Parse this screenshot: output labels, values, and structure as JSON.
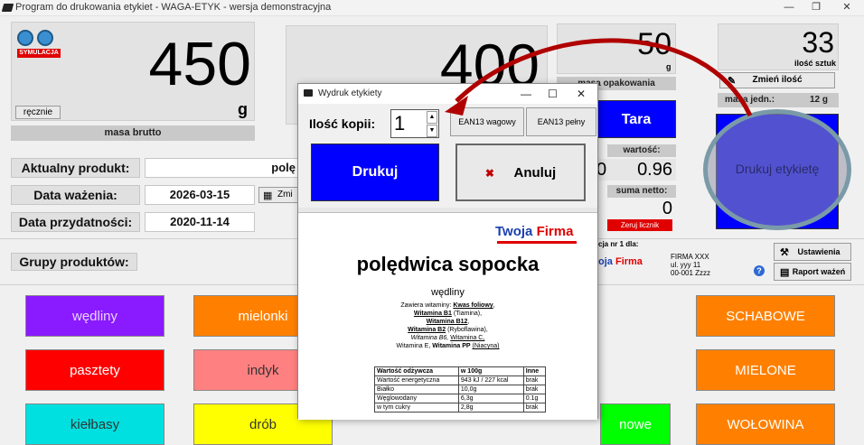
{
  "window": {
    "title": "Program do drukowania etykiet - WAGA-ETYK - wersja demonstracyjna",
    "btn_min": "—",
    "btn_restore": "❐",
    "btn_close": "✕"
  },
  "scale": {
    "mode_badge": "SYMULACJA",
    "manual_btn": "ręcznie",
    "gross_value": "450",
    "gross_unit": "g",
    "gross_caption": "masa brutto",
    "net_value": "400",
    "tare_value": "50",
    "tare_unit": "g",
    "tare_caption": "masa opakowania",
    "tara_btn": "Tara"
  },
  "count": {
    "value": "33",
    "caption": "ilość sztuk",
    "change_btn": "Zmień ilość",
    "unit_mass_label": "masa jedn.:",
    "unit_mass_value": "12 g",
    "print_label_btn": "Drukuj etykietę"
  },
  "values": {
    "value_label": "wartość:",
    "value_shown": "0.96",
    "value_partial": "0",
    "sum_label": "suma netto:",
    "sum_value": "0",
    "reset_btn": "Zeruj licznik"
  },
  "product": {
    "current_label": "Aktualny produkt:",
    "current_value": "polę",
    "weigh_date_label": "Data ważenia:",
    "weigh_date_value": "2026-03-15",
    "change_btn_partial": "Zmi",
    "expiry_label": "Data przydatności:",
    "expiry_value": "2020-11-14"
  },
  "company": {
    "prefix_text": "cja nr 1 dla:",
    "logo_partial_a": "oja",
    "logo_partial_b": "Firma",
    "name": "FIRMA XXX",
    "addr1": "ul. yyy 11",
    "addr2": "00-001 Zzzz",
    "settings_btn": "Ustawienia",
    "report_btn": "Raport ważeń"
  },
  "groups": {
    "label": "Grupy produktów:",
    "items": [
      {
        "label": "wędliny",
        "bg": "#8a1aff",
        "fg": "#e8d5ff"
      },
      {
        "label": "mielonki",
        "bg": "#ff8000",
        "fg": "#ffffff"
      },
      {
        "label": "SCHABOWE",
        "bg": "#ff8000",
        "fg": "#ffffff"
      },
      {
        "label": "pasztety",
        "bg": "#ff0000",
        "fg": "#ffffff"
      },
      {
        "label": "indyk",
        "bg": "#ff8080",
        "fg": "#333333"
      },
      {
        "label": "MIELONE",
        "bg": "#ff8000",
        "fg": "#ffffff"
      },
      {
        "label": "kiełbasy",
        "bg": "#00e0e0",
        "fg": "#333333"
      },
      {
        "label": "drób",
        "bg": "#ffff00",
        "fg": "#333333"
      },
      {
        "label": "nowe",
        "bg": "#00ff00",
        "fg": "#ffffff"
      },
      {
        "label": "WOŁOWINA",
        "bg": "#ff8000",
        "fg": "#ffffff"
      }
    ]
  },
  "dialog": {
    "title": "Wydruk etykiety",
    "copies_label": "Ilość kopii:",
    "copies_value": "1",
    "ean_weight_btn": "EAN13 wagowy",
    "ean_full_btn": "EAN13 pełny",
    "print_btn": "Drukuj",
    "cancel_btn": "Anuluj",
    "cancel_glyph": "✖"
  },
  "label": {
    "logo_a": "Twoja",
    "logo_b": "Firma",
    "product_name": "polędwica sopocka",
    "group": "wędliny",
    "vit_line1_a": "Zawiera witaminy:",
    "vit_line1_b": "Kwas foliowy",
    "vit_line2_a": "Witamina B1",
    "vit_line2_b": "(Tiamina),",
    "vit_line3_a": "Witamina B12",
    "vit_line4_a": "Witamina B2",
    "vit_line4_b": "(Ryboflawina),",
    "vit_line5_a": "Witamina B6,",
    "vit_line5_b": "Witamina C,",
    "vit_line6_a": "Witamina E,",
    "vit_line6_b": "Witamina PP",
    "vit_line6_c": "(Niacyna)",
    "nutrition": {
      "headers": [
        "Wartość odżywcza",
        "w 100g",
        "Inne"
      ],
      "rows": [
        [
          "Wartość energetyczna",
          "943 kJ / 227 kcal",
          "brak"
        ],
        [
          "Białko",
          "10,0g",
          "brak"
        ],
        [
          "Węglowodany",
          "6,3g",
          "0.1g"
        ],
        [
          "w tym cukry",
          "2,8g",
          "brak"
        ]
      ]
    }
  },
  "colors": {
    "blue_button": "#0000ff",
    "annotation_red": "#b00000",
    "annotation_ring": "#7a9aa8"
  }
}
